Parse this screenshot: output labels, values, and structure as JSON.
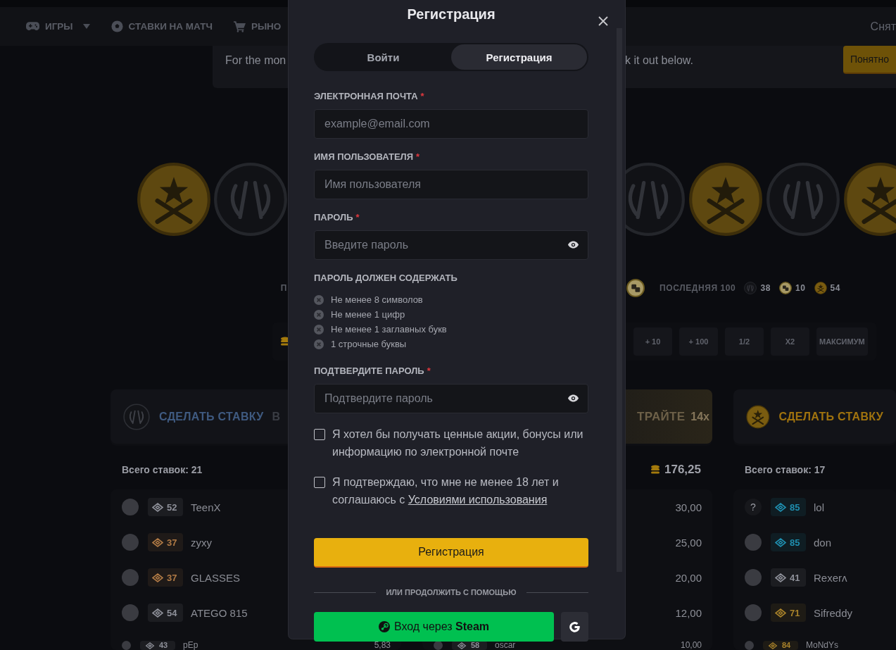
{
  "nav": {
    "items": [
      {
        "kind": "games",
        "label": "ИГРЫ",
        "dropdown": true
      },
      {
        "kind": "match",
        "label": "СТАВКИ НА МАТЧ",
        "dropdown": false
      },
      {
        "kind": "market",
        "label": "РЫНО",
        "dropdown": false
      }
    ],
    "right_label": "Снят"
  },
  "banner": {
    "text_left": "For the mon",
    "text_right": "k it out below.",
    "button": "Понятно"
  },
  "stats": {
    "label_fragment": "П",
    "last_label": "ПОСЛЕДНЯЯ 100",
    "counts": [
      {
        "kind": "ct",
        "value": "38"
      },
      {
        "kind": "dice",
        "value": "10"
      },
      {
        "kind": "t",
        "value": "54"
      }
    ]
  },
  "bet_controls": {
    "buttons": [
      "+ 10",
      "+ 100",
      "1/2",
      "X2",
      "МАКСИМУМ"
    ]
  },
  "columns": [
    {
      "kind": "ct",
      "title": "СДЕЛАТЬ СТАВКУ",
      "title_fragment": "В",
      "total_label": "Всего ставок: 21",
      "rows": [
        {
          "name": "TeenX",
          "rank": "52",
          "color": "#8e9099"
        },
        {
          "name": "zyxy",
          "rank": "37",
          "color": "#b07a45"
        },
        {
          "name": "GLASSES",
          "rank": "37",
          "color": "#b07a45"
        },
        {
          "name": "ATEGO 815",
          "rank": "54",
          "color": "#8e9099"
        },
        {
          "name": "pEp",
          "rank": "43",
          "color": "#8e9099",
          "amount": "5,83"
        }
      ]
    },
    {
      "kind": "bonus",
      "title": "ТРАЙТЕ",
      "multiplier": "14x",
      "total_amount": "176,25",
      "rows": [
        {
          "amount": "30,00"
        },
        {
          "amount": "25,00"
        },
        {
          "amount": "20,00"
        },
        {
          "amount": "12,00"
        },
        {
          "name": "oscar",
          "rank": "58",
          "color": "#8e9099",
          "amount": "10,00"
        }
      ]
    },
    {
      "kind": "t",
      "title": "СДЕЛАТЬ СТАВКУ",
      "total_label": "Всего ставок: 17",
      "rows": [
        {
          "name": "lol",
          "rank": "85",
          "color": "#1f8fb0",
          "avatar_text": "?"
        },
        {
          "name": "don",
          "rank": "85",
          "color": "#1f8fb0"
        },
        {
          "name": "Rexerᴧ",
          "rank": "41",
          "color": "#8e9099"
        },
        {
          "name": "Sifreddy",
          "rank": "71",
          "color": "#a8822a"
        },
        {
          "name": "MoNdYs",
          "rank": "84",
          "color": "#a8822a"
        }
      ]
    }
  ],
  "modal": {
    "title": "Регистрация",
    "tabs": [
      {
        "label": "Войти",
        "selected": false
      },
      {
        "label": "Регистрация",
        "selected": true
      }
    ],
    "fields": [
      {
        "kind": "email",
        "label": "ЭЛЕКТРОННАЯ ПОЧТА",
        "required_mark": "*",
        "placeholder": "example@email.com"
      },
      {
        "kind": "text",
        "label": "ИМЯ ПОЛЬЗОВАТЕЛЯ",
        "required_mark": "*",
        "placeholder": "Имя пользователя"
      },
      {
        "kind": "password",
        "label": "ПАРОЛЬ",
        "required_mark": "*",
        "placeholder": "Введите пароль"
      }
    ],
    "password_rules": {
      "title": "ПАРОЛЬ ДОЛЖЕН СОДЕРЖАТЬ",
      "items": [
        {
          "text": "Не менее 8 символов",
          "met": false
        },
        {
          "text": "Не менее 1 цифр",
          "met": false
        },
        {
          "text": "Не менее 1 заглавных букв",
          "met": false
        },
        {
          "text": "1 строчные буквы",
          "met": false
        }
      ]
    },
    "confirm_field": {
      "kind": "password",
      "label": "ПОДТВЕРДИТЕ ПАРОЛЬ",
      "required_mark": "*",
      "placeholder": "Подтвердите пароль"
    },
    "consents": [
      {
        "text": "Я хотел бы получать ценные акции, бонусы или информацию по электронной почте",
        "checked": false
      },
      {
        "text": "Я подтверждаю, что мне не менее 18 лет и соглашаюсь с",
        "link": "Условиями использования",
        "checked": false
      }
    ],
    "submit": "Регистрация",
    "divider": "ИЛИ ПРОДОЛЖИТЬ С ПОМОЩЬЮ",
    "steam_button": "Вход через **Steam**"
  }
}
